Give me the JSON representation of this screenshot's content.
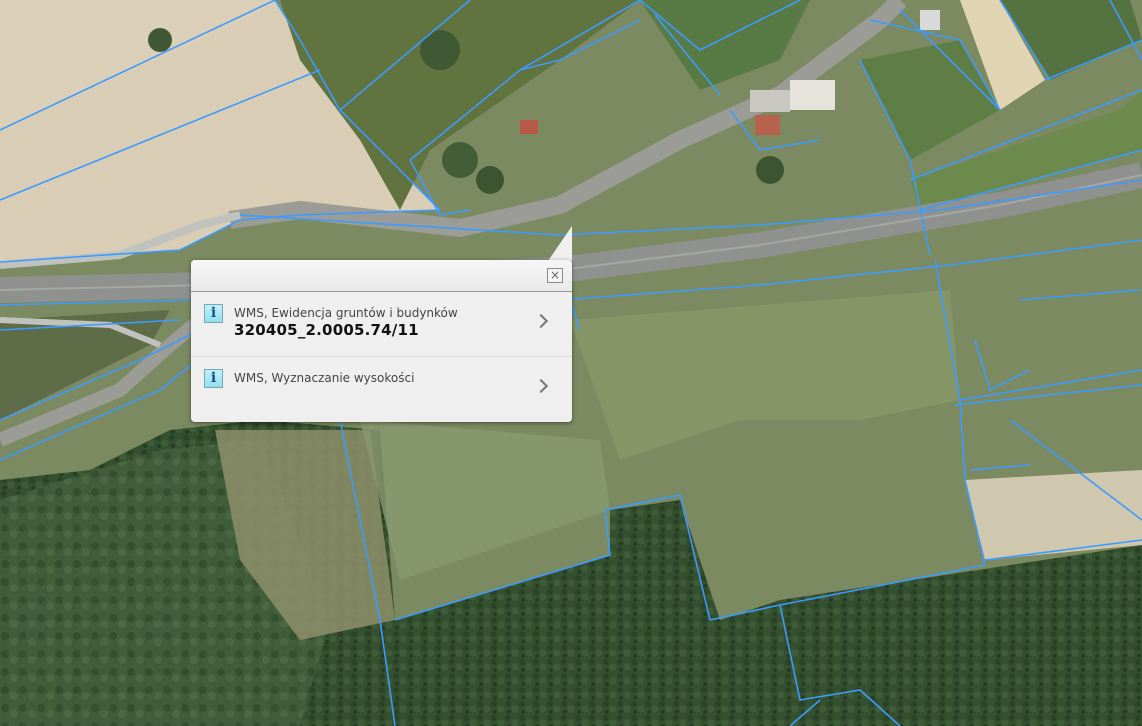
{
  "map": {
    "colors": {
      "parcel_line": "#3d9bff",
      "field_light": "#d8ccb4",
      "forest_dark": "#2f4a2e",
      "meadow": "#7e8c62",
      "road": "#8c8f8a"
    }
  },
  "popup": {
    "close_icon": "×",
    "items": [
      {
        "icon": "i",
        "source": "WMS, Ewidencja gruntów i budynków",
        "value": "320405_2.0005.74/11"
      },
      {
        "icon": "i",
        "source": "WMS, Wyznaczanie wysokości",
        "value": ""
      }
    ]
  }
}
